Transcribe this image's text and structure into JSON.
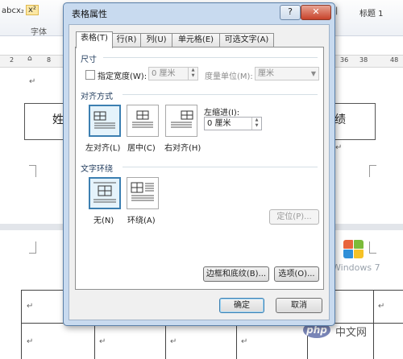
{
  "background": {
    "ribbon": {
      "font_buttons": [
        "abc",
        "x₂",
        "x²"
      ],
      "font_group_label": "字体",
      "style_name": "标题 1"
    },
    "ruler_numbers": [
      "2",
      "8",
      "36",
      "38",
      "48"
    ],
    "document": {
      "table_left_text": "姓",
      "table_right_text": "成绩",
      "watermark": "Windows 7",
      "site_logo": "php",
      "site_name": "中文网"
    }
  },
  "dialog": {
    "title": "表格属性",
    "help_button": "?",
    "close_button": "✕",
    "tabs": [
      {
        "label": "表格(T)",
        "active": true
      },
      {
        "label": "行(R)",
        "active": false
      },
      {
        "label": "列(U)",
        "active": false
      },
      {
        "label": "单元格(E)",
        "active": false
      },
      {
        "label": "可选文字(A)",
        "active": false
      }
    ],
    "size": {
      "group_label": "尺寸",
      "preferred_width_label": "指定宽度(W):",
      "width_value": "0 厘米",
      "measure_label": "度量单位(M):",
      "measure_value": "厘米"
    },
    "alignment": {
      "group_label": "对齐方式",
      "options": [
        "左对齐(L)",
        "居中(C)",
        "右对齐(H)"
      ],
      "selected": 0,
      "indent_label": "左缩进(I):",
      "indent_value": "0 厘米"
    },
    "wrapping": {
      "group_label": "文字环绕",
      "options": [
        "无(N)",
        "环绕(A)"
      ],
      "selected": 0,
      "position_button": "定位(P)..."
    },
    "borders_button": "边框和底纹(B)...",
    "options_button": "选项(O)...",
    "ok_button": "确定",
    "cancel_button": "取消"
  }
}
